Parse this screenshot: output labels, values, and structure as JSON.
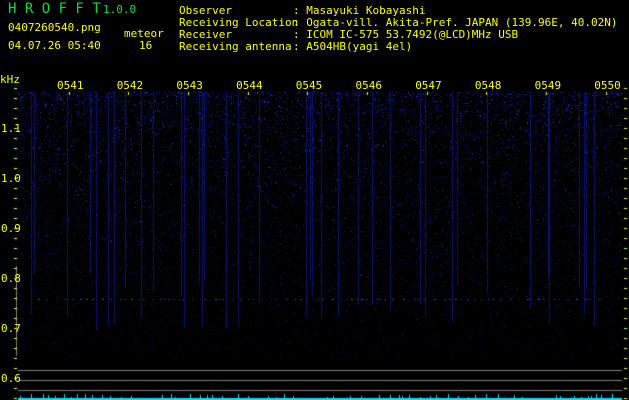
{
  "header": {
    "app_name": "H R O F F T",
    "version": "1.0.0",
    "filename": "0407260540.png",
    "datetime": "04.07.26 05:40",
    "meteor_label": "meteor",
    "meteor_count": "16",
    "info": [
      {
        "label": "Observer",
        "value": ": Masayuki Kobayashi"
      },
      {
        "label": "Receiving Location",
        "value": ": Ogata-vill. Akita-Pref. JAPAN (139.96E, 40.02N)"
      },
      {
        "label": "Receiver",
        "value": ": ICOM IC-575 53.7492(@LCD)MHz USB"
      },
      {
        "label": "Receiving antenna",
        "value": ": A504HB(yagi 4el)"
      }
    ]
  },
  "colors": {
    "text": "#ffff00",
    "logo": "#00e040",
    "noise": "#0a1aa0",
    "echo_high": "#ff2060",
    "echo_mid": "#00ff80",
    "histogram_major": "#ffff00",
    "histogram_minor": "#00e0ff"
  },
  "chart_data": {
    "type": "heatmap",
    "ylabel": "kHz",
    "x_ticks": [
      "0541",
      "0542",
      "0543",
      "0544",
      "0545",
      "0546",
      "0547",
      "0548",
      "0549",
      "0550"
    ],
    "y_ticks": [
      "1.1",
      "1.0",
      "0.9",
      "0.8",
      "0.7",
      "0.6"
    ],
    "ylim": [
      0.56,
      1.22
    ],
    "echo_center_khz": 0.76,
    "echoes": [
      {
        "time": "0540:45",
        "strength": "strong"
      },
      {
        "time": "0541:30",
        "strength": "weak"
      },
      {
        "time": "0542:33",
        "strength": "strong"
      },
      {
        "time": "0543:20",
        "strength": "medium"
      },
      {
        "time": "0543:59",
        "strength": "strong"
      },
      {
        "time": "0544:04",
        "strength": "strong"
      },
      {
        "time": "0544:54",
        "strength": "weak"
      },
      {
        "time": "0546:50",
        "strength": "strong"
      },
      {
        "time": "0547:30",
        "strength": "strong"
      },
      {
        "time": "0548:02",
        "strength": "medium"
      },
      {
        "time": "0548:10",
        "strength": "weak"
      }
    ]
  }
}
